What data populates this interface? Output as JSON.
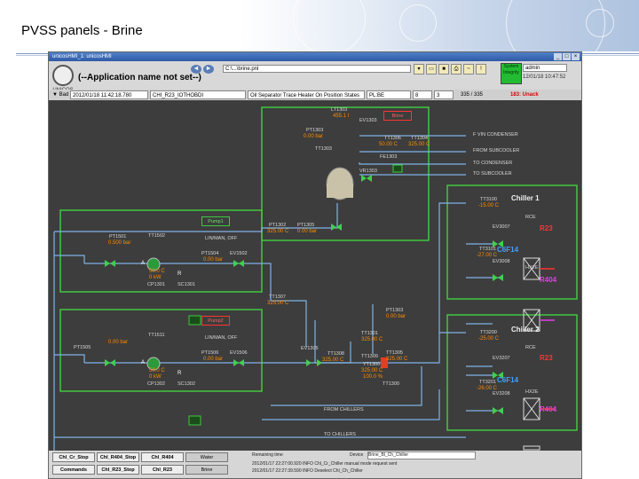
{
  "slide": {
    "title": "PVSS panels - Brine"
  },
  "window": {
    "title": "unicosHMI_1: unicosHMI",
    "app_name": "(--Application name not set--)",
    "logo_text": "UNICOS",
    "path": "C:\\...\\brine.pnl",
    "system_button": "System Integrity",
    "user": "admin",
    "datetime": "12/01/18 10:47:52"
  },
  "status_bar": {
    "state": "Bad",
    "timestamp": "2012/01/18 11:42:18.780",
    "object": "CHI_R23_IOTHOBDI",
    "description": "Oil Separator Trace Heater On Position States",
    "alias": "PL:BE",
    "field1": "8",
    "field2": "3",
    "count": "335 / 335",
    "unack": "183: Unack"
  },
  "schematic": {
    "tank": {
      "tag_top": "LT1303",
      "level": "455.1 l",
      "tag_p": "PT1303",
      "pressure": "0.00 bar",
      "tag_temp": "TT1303",
      "tag_valve": "EV1303",
      "tag_bottom": "VR1303",
      "tag_flow": "FE1303",
      "tag_brine": "Brine"
    },
    "header_block": {
      "tags": [
        "TT1306",
        "TT1304"
      ],
      "values": [
        "50.00 C",
        "325.00 C"
      ]
    },
    "outlets": [
      "F VIN CONDENSER",
      "FROM SUBCOOLER",
      "TO CONDENSER",
      "TO SUBCOOLER"
    ],
    "line_mid": {
      "tags": [
        "PT1302",
        "PT1305"
      ],
      "values": [
        "325.00 C",
        "0.00 bar"
      ]
    },
    "pump1": {
      "label": "Pump1",
      "status": "LIN/MAN, OFF",
      "tag_in": "PT1501",
      "in_value": "0.500 bar",
      "tags": [
        "TT1502",
        "PT1504",
        "EV1502"
      ],
      "outlet_value": "0.00 bar",
      "temp": "50.0 C",
      "speed": "0 kW",
      "pump_tag": "CP1301",
      "ctrl": "R",
      "ctrl_tag": "SC1301",
      "marker": "A"
    },
    "pump2": {
      "label": "Pump2",
      "status": "LIN/MAN, OFF",
      "tag_in": "PT1505",
      "in_value": "0.00 bar",
      "tags": [
        "TT1511",
        "PT1506",
        "EV1506"
      ],
      "outlet_value": "0.00 bar",
      "temp": "50.0 C",
      "speed": "0 kW",
      "pump_tag": "CP1302",
      "ctrl": "R",
      "ctrl_tag": "SC1302",
      "marker": "A"
    },
    "return_line": {
      "tt_tag": "TT1307",
      "tt_value": "325.00 C",
      "pt_tag": "PT1303",
      "pt_value": "0.00 bar",
      "valve_tag": "EV1305",
      "tt2_tag": "TT1308",
      "tt2_value": "325.00 C",
      "heater_tag": "TT1309",
      "heater_value": "325.00 C",
      "tt3_tag": "TT1305",
      "tt3_value": "325.00 C",
      "v_tag": "YT1300",
      "pct": "100.0 %",
      "mid_tag": "TT1301",
      "mid_value": "325.00 C",
      "bottom_tag": "TT1300",
      "from": "FROM CHILLERS",
      "to": "TO CHILLERS"
    },
    "chiller1": {
      "title": "Chiller 1",
      "tag_t": "TT3100",
      "temp": "-15.00 C",
      "tag_ev1": "EV3007",
      "tag_ev2": "EV3008",
      "tag_t2": "TT3101",
      "temp2": "-27.00 C",
      "tag_r1": "R23",
      "tag_r2": "R404",
      "tag_c": "C6F14",
      "hx1": "RCE",
      "hx2": "HX2E"
    },
    "chiller2": {
      "title": "Chiller 2",
      "tag_t": "TT3200",
      "temp": "-25.00 C",
      "tag_ev1": "EV3207",
      "tag_ev2": "EV3208",
      "tag_t2": "TT3201",
      "temp2": "-26.00 C",
      "tag_r1": "R23",
      "tag_r2": "R404",
      "tag_c": "C6F14",
      "hx1": "RCE",
      "hx2": "HX2E"
    }
  },
  "bottom": {
    "row1": [
      "Chl_Cr_Stop",
      "Chl_R404_Stop",
      "Chl_R404",
      "Water"
    ],
    "row2": [
      "Commands",
      "Chl_R23_Stop",
      "Chl_R23",
      "Brine"
    ],
    "remaining": "Remaining time",
    "device": "Device",
    "device_value": "Brine_Bl_Ch_Chiller",
    "messages": [
      "2012/01/17 22:27:00.920 INFO   Chl_Cr_Chiller manual mode request sent",
      "2012/01/17 22:27:39.590 INFO   Deselect Chl_Ch_Chiller"
    ]
  },
  "colors": {
    "panel_bg": "#3d3d3d",
    "frame_green": "#40c840",
    "pipe_blue": "#7fb3e6",
    "value_orange": "#ff8a00",
    "r23": "#ff3333",
    "r404": "#e040e0",
    "c6f14": "#40a0ff"
  }
}
